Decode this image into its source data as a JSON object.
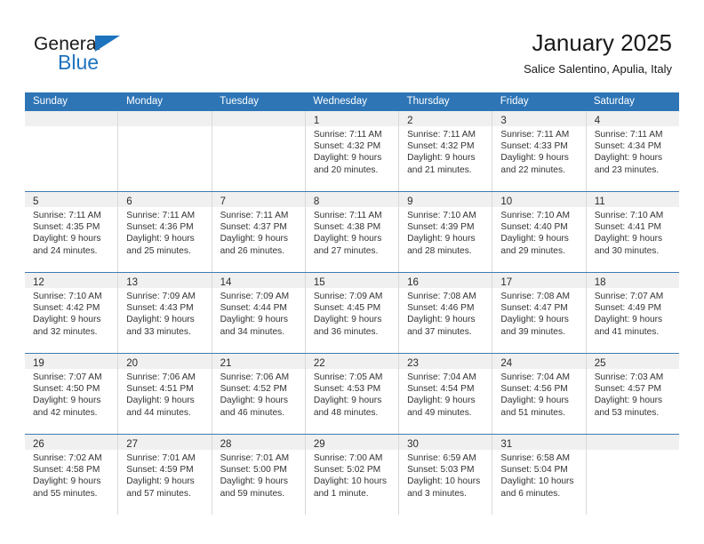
{
  "brand": {
    "name_top": "General",
    "name_bottom": "Blue",
    "color_blue": "#1e73be"
  },
  "header": {
    "title": "January 2025",
    "subtitle": "Salice Salentino, Apulia, Italy"
  },
  "theme": {
    "header_row_bg": "#2e75b6",
    "daynum_band_bg": "#f0f0f0",
    "cell_border": "#d9d9d9",
    "week_divider": "#3e7cb1"
  },
  "weekdays": [
    "Sunday",
    "Monday",
    "Tuesday",
    "Wednesday",
    "Thursday",
    "Friday",
    "Saturday"
  ],
  "weeks": [
    [
      {
        "day": "",
        "sunrise": "",
        "sunset": "",
        "daylight_1": "",
        "daylight_2": ""
      },
      {
        "day": "",
        "sunrise": "",
        "sunset": "",
        "daylight_1": "",
        "daylight_2": ""
      },
      {
        "day": "",
        "sunrise": "",
        "sunset": "",
        "daylight_1": "",
        "daylight_2": ""
      },
      {
        "day": "1",
        "sunrise": "Sunrise: 7:11 AM",
        "sunset": "Sunset: 4:32 PM",
        "daylight_1": "Daylight: 9 hours",
        "daylight_2": "and 20 minutes."
      },
      {
        "day": "2",
        "sunrise": "Sunrise: 7:11 AM",
        "sunset": "Sunset: 4:32 PM",
        "daylight_1": "Daylight: 9 hours",
        "daylight_2": "and 21 minutes."
      },
      {
        "day": "3",
        "sunrise": "Sunrise: 7:11 AM",
        "sunset": "Sunset: 4:33 PM",
        "daylight_1": "Daylight: 9 hours",
        "daylight_2": "and 22 minutes."
      },
      {
        "day": "4",
        "sunrise": "Sunrise: 7:11 AM",
        "sunset": "Sunset: 4:34 PM",
        "daylight_1": "Daylight: 9 hours",
        "daylight_2": "and 23 minutes."
      }
    ],
    [
      {
        "day": "5",
        "sunrise": "Sunrise: 7:11 AM",
        "sunset": "Sunset: 4:35 PM",
        "daylight_1": "Daylight: 9 hours",
        "daylight_2": "and 24 minutes."
      },
      {
        "day": "6",
        "sunrise": "Sunrise: 7:11 AM",
        "sunset": "Sunset: 4:36 PM",
        "daylight_1": "Daylight: 9 hours",
        "daylight_2": "and 25 minutes."
      },
      {
        "day": "7",
        "sunrise": "Sunrise: 7:11 AM",
        "sunset": "Sunset: 4:37 PM",
        "daylight_1": "Daylight: 9 hours",
        "daylight_2": "and 26 minutes."
      },
      {
        "day": "8",
        "sunrise": "Sunrise: 7:11 AM",
        "sunset": "Sunset: 4:38 PM",
        "daylight_1": "Daylight: 9 hours",
        "daylight_2": "and 27 minutes."
      },
      {
        "day": "9",
        "sunrise": "Sunrise: 7:10 AM",
        "sunset": "Sunset: 4:39 PM",
        "daylight_1": "Daylight: 9 hours",
        "daylight_2": "and 28 minutes."
      },
      {
        "day": "10",
        "sunrise": "Sunrise: 7:10 AM",
        "sunset": "Sunset: 4:40 PM",
        "daylight_1": "Daylight: 9 hours",
        "daylight_2": "and 29 minutes."
      },
      {
        "day": "11",
        "sunrise": "Sunrise: 7:10 AM",
        "sunset": "Sunset: 4:41 PM",
        "daylight_1": "Daylight: 9 hours",
        "daylight_2": "and 30 minutes."
      }
    ],
    [
      {
        "day": "12",
        "sunrise": "Sunrise: 7:10 AM",
        "sunset": "Sunset: 4:42 PM",
        "daylight_1": "Daylight: 9 hours",
        "daylight_2": "and 32 minutes."
      },
      {
        "day": "13",
        "sunrise": "Sunrise: 7:09 AM",
        "sunset": "Sunset: 4:43 PM",
        "daylight_1": "Daylight: 9 hours",
        "daylight_2": "and 33 minutes."
      },
      {
        "day": "14",
        "sunrise": "Sunrise: 7:09 AM",
        "sunset": "Sunset: 4:44 PM",
        "daylight_1": "Daylight: 9 hours",
        "daylight_2": "and 34 minutes."
      },
      {
        "day": "15",
        "sunrise": "Sunrise: 7:09 AM",
        "sunset": "Sunset: 4:45 PM",
        "daylight_1": "Daylight: 9 hours",
        "daylight_2": "and 36 minutes."
      },
      {
        "day": "16",
        "sunrise": "Sunrise: 7:08 AM",
        "sunset": "Sunset: 4:46 PM",
        "daylight_1": "Daylight: 9 hours",
        "daylight_2": "and 37 minutes."
      },
      {
        "day": "17",
        "sunrise": "Sunrise: 7:08 AM",
        "sunset": "Sunset: 4:47 PM",
        "daylight_1": "Daylight: 9 hours",
        "daylight_2": "and 39 minutes."
      },
      {
        "day": "18",
        "sunrise": "Sunrise: 7:07 AM",
        "sunset": "Sunset: 4:49 PM",
        "daylight_1": "Daylight: 9 hours",
        "daylight_2": "and 41 minutes."
      }
    ],
    [
      {
        "day": "19",
        "sunrise": "Sunrise: 7:07 AM",
        "sunset": "Sunset: 4:50 PM",
        "daylight_1": "Daylight: 9 hours",
        "daylight_2": "and 42 minutes."
      },
      {
        "day": "20",
        "sunrise": "Sunrise: 7:06 AM",
        "sunset": "Sunset: 4:51 PM",
        "daylight_1": "Daylight: 9 hours",
        "daylight_2": "and 44 minutes."
      },
      {
        "day": "21",
        "sunrise": "Sunrise: 7:06 AM",
        "sunset": "Sunset: 4:52 PM",
        "daylight_1": "Daylight: 9 hours",
        "daylight_2": "and 46 minutes."
      },
      {
        "day": "22",
        "sunrise": "Sunrise: 7:05 AM",
        "sunset": "Sunset: 4:53 PM",
        "daylight_1": "Daylight: 9 hours",
        "daylight_2": "and 48 minutes."
      },
      {
        "day": "23",
        "sunrise": "Sunrise: 7:04 AM",
        "sunset": "Sunset: 4:54 PM",
        "daylight_1": "Daylight: 9 hours",
        "daylight_2": "and 49 minutes."
      },
      {
        "day": "24",
        "sunrise": "Sunrise: 7:04 AM",
        "sunset": "Sunset: 4:56 PM",
        "daylight_1": "Daylight: 9 hours",
        "daylight_2": "and 51 minutes."
      },
      {
        "day": "25",
        "sunrise": "Sunrise: 7:03 AM",
        "sunset": "Sunset: 4:57 PM",
        "daylight_1": "Daylight: 9 hours",
        "daylight_2": "and 53 minutes."
      }
    ],
    [
      {
        "day": "26",
        "sunrise": "Sunrise: 7:02 AM",
        "sunset": "Sunset: 4:58 PM",
        "daylight_1": "Daylight: 9 hours",
        "daylight_2": "and 55 minutes."
      },
      {
        "day": "27",
        "sunrise": "Sunrise: 7:01 AM",
        "sunset": "Sunset: 4:59 PM",
        "daylight_1": "Daylight: 9 hours",
        "daylight_2": "and 57 minutes."
      },
      {
        "day": "28",
        "sunrise": "Sunrise: 7:01 AM",
        "sunset": "Sunset: 5:00 PM",
        "daylight_1": "Daylight: 9 hours",
        "daylight_2": "and 59 minutes."
      },
      {
        "day": "29",
        "sunrise": "Sunrise: 7:00 AM",
        "sunset": "Sunset: 5:02 PM",
        "daylight_1": "Daylight: 10 hours",
        "daylight_2": "and 1 minute."
      },
      {
        "day": "30",
        "sunrise": "Sunrise: 6:59 AM",
        "sunset": "Sunset: 5:03 PM",
        "daylight_1": "Daylight: 10 hours",
        "daylight_2": "and 3 minutes."
      },
      {
        "day": "31",
        "sunrise": "Sunrise: 6:58 AM",
        "sunset": "Sunset: 5:04 PM",
        "daylight_1": "Daylight: 10 hours",
        "daylight_2": "and 6 minutes."
      },
      {
        "day": "",
        "sunrise": "",
        "sunset": "",
        "daylight_1": "",
        "daylight_2": ""
      }
    ]
  ]
}
